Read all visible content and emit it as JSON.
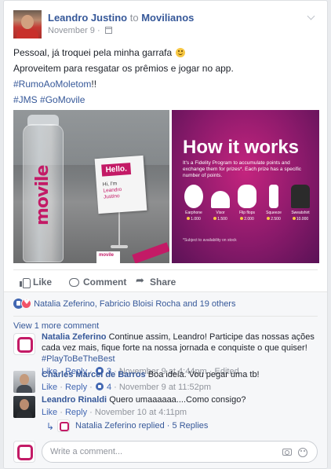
{
  "post": {
    "author": "Leandro Justino",
    "to_word": "to",
    "group": "Movilianos",
    "date": "November 9 ·",
    "text_line1": "Pessoal, já troquei pela minha garrafa",
    "text_line2": "Aproveitem para resgatar os prêmios e jogar no app.",
    "hashtag1": "#RumoAoMoletom",
    "hashtag1_suffix": "!!",
    "hashtag2": "#JMS",
    "hashtag3": "#GoMovile"
  },
  "photo_left": {
    "bottle_logo": "movile",
    "sign_hello": "Hello.",
    "sign_hi": "Hi, I'm",
    "sign_name1": "Leandro",
    "sign_name2": "Justino",
    "box_logo": "movile"
  },
  "photo_right": {
    "title": "How it works",
    "description": "It's a Fidelity Program to accumulate points and exchange them for prizes*. Each prize has a specific number of points.",
    "prizes": [
      {
        "label": "Earphone",
        "points": "1.000"
      },
      {
        "label": "Visor",
        "points": "1.500"
      },
      {
        "label": "Flip flops",
        "points": "2.000"
      },
      {
        "label": "Squeeze",
        "points": "2.500"
      },
      {
        "label": "Sweatshirt",
        "points": "10.000"
      }
    ],
    "note": "*Subject to availability on stock"
  },
  "actions": {
    "like": "Like",
    "comment": "Comment",
    "share": "Share"
  },
  "reactions": {
    "text": "Natalia Zeferino, Fabricio Bloisi Rocha and 19 others"
  },
  "view_more": "View 1 more comment",
  "comments": [
    {
      "author": "Natalia Zeferino",
      "text": "Continue assim, Leandro! Participe das nossas ações cada vez mais, fique forte na nossa jornada e conquiste o que quiser!",
      "hashtag": "#PlayToBeTheBest",
      "like": "Like",
      "reply": "Reply",
      "likes": "3",
      "time": "November 9 at 4:44pm",
      "edited": "· Edited"
    },
    {
      "author": "Charles Marcel de Barros",
      "text": "Boa ideia. Vou pegar uma tb!",
      "like": "Like",
      "reply": "Reply",
      "likes": "4",
      "time": "November 9 at 11:52pm"
    },
    {
      "author": "Leandro Rinaldi",
      "text": "Quero umaaaaaa....Como consigo?",
      "like": "Like",
      "reply": "Reply",
      "time": "November 10 at 4:11pm"
    }
  ],
  "reply_summary": {
    "name": "Natalia Zeferino",
    "text": "replied · 5 Replies"
  },
  "composer": {
    "placeholder": "Write a comment..."
  }
}
